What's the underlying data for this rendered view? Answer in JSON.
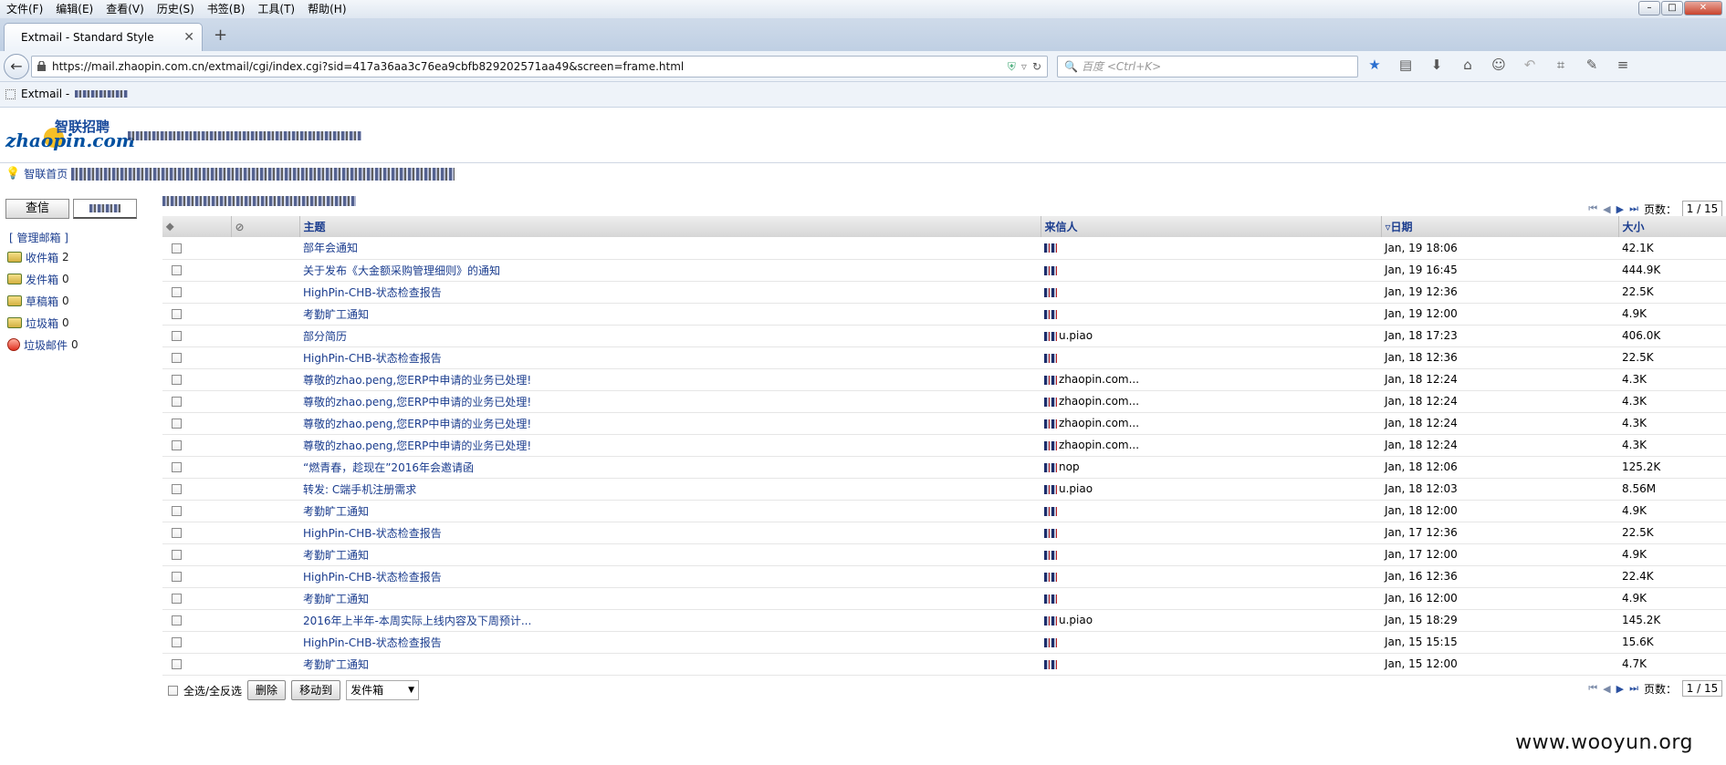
{
  "browser": {
    "menu": [
      "文件(F)",
      "编辑(E)",
      "查看(V)",
      "历史(S)",
      "书签(B)",
      "工具(T)",
      "帮助(H)"
    ],
    "tab_title": "Extmail - Standard Style",
    "url": "https://mail.zhaopin.com.cn/extmail/cgi/index.cgi?sid=417a36aa3c76ea9cbfb829202571aa49&screen=frame.html",
    "search_placeholder": "百度 <Ctrl+K>",
    "bookmark_label": "Extmail -"
  },
  "page": {
    "logo_text": "zhaopin.com",
    "logo_cn": "智联招聘",
    "home_link": "智联首页",
    "buttons": {
      "check": "查信",
      "compose": ""
    },
    "manage_label": "[ 管理邮箱 ]",
    "folders": [
      {
        "name": "收件箱",
        "count": "2",
        "icon": "inbox-icon"
      },
      {
        "name": "发件箱",
        "count": "0",
        "icon": "sent-icon"
      },
      {
        "name": "草稿箱",
        "count": "0",
        "icon": "drafts-icon"
      },
      {
        "name": "垃圾箱",
        "count": "0",
        "icon": "trash-icon"
      },
      {
        "name": "垃圾邮件",
        "count": "0",
        "icon": "spam-icon"
      }
    ],
    "columns": {
      "subject": "主题",
      "from": "来信人",
      "date": "日期",
      "size": "大小"
    },
    "pager": {
      "label": "页数：",
      "value": "1 / 15"
    },
    "emails": [
      {
        "subject": "部年会通知",
        "from": "",
        "date": "Jan, 19 18:06",
        "size": "42.1K"
      },
      {
        "subject": "关于发布《大金额采购管理细则》的通知",
        "from": "",
        "date": "Jan, 19 16:45",
        "size": "444.9K"
      },
      {
        "subject": "HighPin-CHB-状态检查报告",
        "from": "",
        "date": "Jan, 19 12:36",
        "size": "22.5K"
      },
      {
        "subject": "考勤旷工通知",
        "from": "",
        "date": "Jan, 19 12:00",
        "size": "4.9K"
      },
      {
        "subject": "部分简历",
        "from": "u.piao",
        "date": "Jan, 18 17:23",
        "size": "406.0K"
      },
      {
        "subject": "HighPin-CHB-状态检查报告",
        "from": "",
        "date": "Jan, 18 12:36",
        "size": "22.5K"
      },
      {
        "subject": "尊敬的zhao.peng,您ERP中申请的业务已处理!",
        "from": "zhaopin.com...",
        "date": "Jan, 18 12:24",
        "size": "4.3K"
      },
      {
        "subject": "尊敬的zhao.peng,您ERP中申请的业务已处理!",
        "from": "zhaopin.com...",
        "date": "Jan, 18 12:24",
        "size": "4.3K"
      },
      {
        "subject": "尊敬的zhao.peng,您ERP中申请的业务已处理!",
        "from": "zhaopin.com...",
        "date": "Jan, 18 12:24",
        "size": "4.3K"
      },
      {
        "subject": "尊敬的zhao.peng,您ERP中申请的业务已处理!",
        "from": "zhaopin.com...",
        "date": "Jan, 18 12:24",
        "size": "4.3K"
      },
      {
        "subject": "“燃青春，趁现在”2016年会邀请函",
        "from": "nop",
        "date": "Jan, 18 12:06",
        "size": "125.2K"
      },
      {
        "subject": "转发: C端手机注册需求",
        "from": "u.piao",
        "date": "Jan, 18 12:03",
        "size": "8.56M"
      },
      {
        "subject": "考勤旷工通知",
        "from": "",
        "date": "Jan, 18 12:00",
        "size": "4.9K"
      },
      {
        "subject": "HighPin-CHB-状态检查报告",
        "from": "",
        "date": "Jan, 17 12:36",
        "size": "22.5K"
      },
      {
        "subject": "考勤旷工通知",
        "from": "",
        "date": "Jan, 17 12:00",
        "size": "4.9K"
      },
      {
        "subject": "HighPin-CHB-状态检查报告",
        "from": "",
        "date": "Jan, 16 12:36",
        "size": "22.4K"
      },
      {
        "subject": "考勤旷工通知",
        "from": "",
        "date": "Jan, 16 12:00",
        "size": "4.9K"
      },
      {
        "subject": " 2016年上半年-本周实际上线内容及下周预计...",
        "from": "u.piao",
        "date": "Jan, 15 18:29",
        "size": "145.2K"
      },
      {
        "subject": "HighPin-CHB-状态检查报告",
        "from": "",
        "date": "Jan, 15 15:15",
        "size": "15.6K"
      },
      {
        "subject": "考勤旷工通知",
        "from": "",
        "date": "Jan, 15 12:00",
        "size": "4.7K"
      }
    ],
    "bottom": {
      "select_all": "全选/全反选",
      "delete": "删除",
      "move_to": "移动到",
      "target_folder": "发件箱"
    },
    "watermark": "www.wooyun.org"
  }
}
